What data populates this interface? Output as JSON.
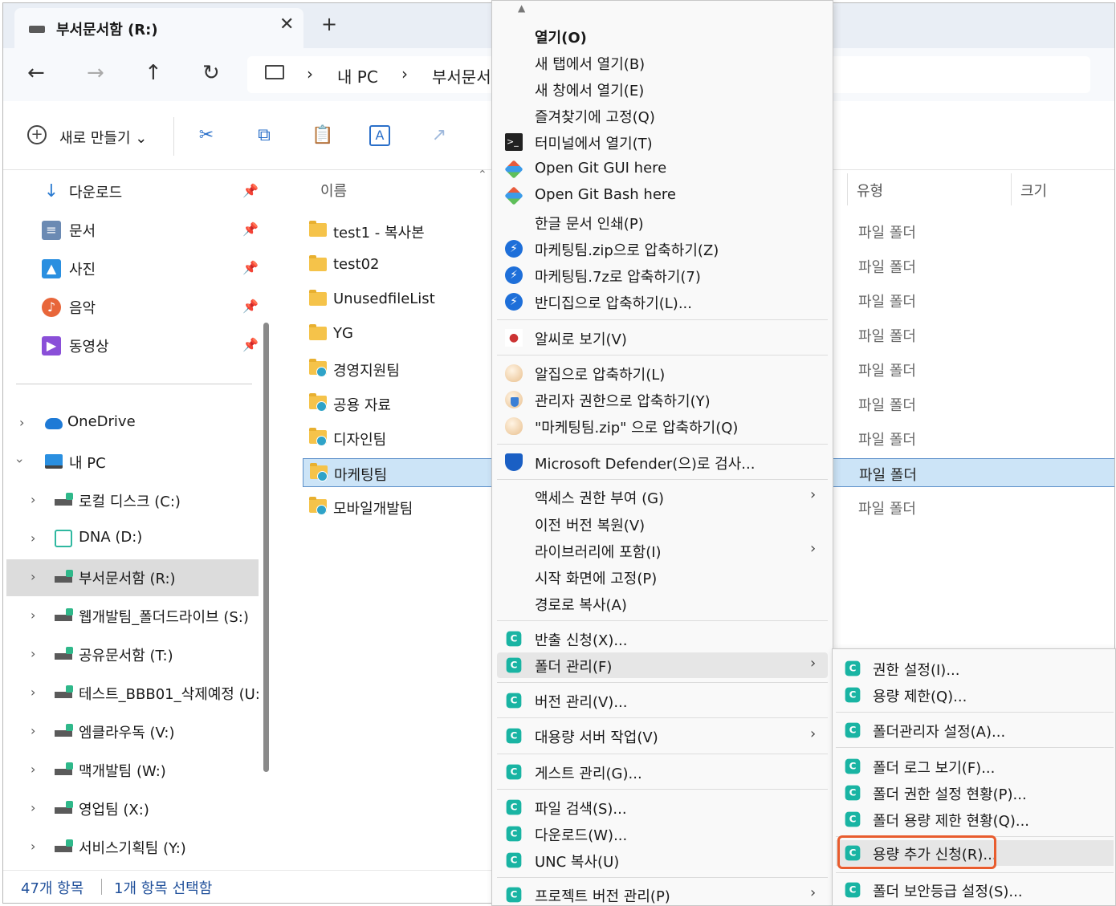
{
  "window": {
    "tab_title": "부서문서함 (R:)",
    "tab_close": "✕",
    "new_tab": "+"
  },
  "nav": {
    "back": "←",
    "forward": "→",
    "up": "↑",
    "refresh": "↻",
    "crumb_sep": "›",
    "breadcrumb": [
      "내 PC",
      "부서문서함 (R:)"
    ]
  },
  "toolbar": {
    "new_label": "새로 만들기 ⌄",
    "cut": "✂",
    "copy": "⧉",
    "paste": "📋",
    "rename": "A",
    "share": "↗"
  },
  "sidebar": {
    "quick_access": [
      {
        "label": "다운로드",
        "icon": "download-icon",
        "glyph": "↓",
        "color": "#2b7bd1"
      },
      {
        "label": "문서",
        "icon": "document-icon",
        "glyph": "≡",
        "color": "#6b8ab3"
      },
      {
        "label": "사진",
        "icon": "pictures-icon",
        "glyph": "▲",
        "color": "#2a8fe0"
      },
      {
        "label": "음악",
        "icon": "music-icon",
        "glyph": "♪",
        "color": "#e8663a"
      },
      {
        "label": "동영상",
        "icon": "video-icon",
        "glyph": "▶",
        "color": "#8a4fd8"
      }
    ],
    "pin_glyph": "📌",
    "onedrive": "OneDrive",
    "this_pc": "내 PC",
    "drives": [
      "로컬 디스크 (C:)",
      "DNA (D:)",
      "부서문서함 (R:)",
      "웹개발팀_폴더드라이브 (S:)",
      "공유문서함 (T:)",
      "테스트_BBB01_삭제예정 (U:",
      "엠클라우독 (V:)",
      "맥개발팀 (W:)",
      "영업팀 (X:)",
      "서비스기획팀 (Y:)"
    ]
  },
  "status": {
    "count": "47개 항목",
    "selected": "1개 항목 선택함"
  },
  "filelist": {
    "columns": {
      "name": "이름",
      "type": "유형",
      "size": "크기"
    },
    "sort_arrow": "⌃",
    "files": [
      {
        "name": "test1 - 복사본",
        "type": "파일 폴더",
        "shared": false
      },
      {
        "name": "test02",
        "type": "파일 폴더",
        "shared": false
      },
      {
        "name": "UnusedfileList",
        "type": "파일 폴더",
        "shared": false
      },
      {
        "name": "YG",
        "type": "파일 폴더",
        "shared": false
      },
      {
        "name": "경영지원팀",
        "type": "파일 폴더",
        "shared": true
      },
      {
        "name": "공용 자료",
        "type": "파일 폴더",
        "shared": true
      },
      {
        "name": "디자인팀",
        "type": "파일 폴더",
        "shared": true
      },
      {
        "name": "마케팅팀",
        "type": "파일 폴더",
        "shared": true
      },
      {
        "name": "모바일개발팀",
        "type": "파일 폴더",
        "shared": true
      }
    ]
  },
  "context_menu": {
    "items": [
      {
        "label": "열기(O)",
        "icon": "",
        "bold": true
      },
      {
        "label": "새 탭에서 열기(B)",
        "icon": ""
      },
      {
        "label": "새 창에서 열기(E)",
        "icon": ""
      },
      {
        "label": "즐겨찾기에 고정(Q)",
        "icon": ""
      },
      {
        "label": "터미널에서 열기(T)",
        "icon": "terminal-icon"
      },
      {
        "label": "Open Git GUI here",
        "icon": "git-icon"
      },
      {
        "label": "Open Git Bash here",
        "icon": "git-icon"
      },
      {
        "label": "한글 문서 인쇄(P)",
        "icon": ""
      },
      {
        "label": "마케팅팀.zip으로 압축하기(Z)",
        "icon": "bandizip-icon"
      },
      {
        "label": "마케팅팀.7z로 압축하기(7)",
        "icon": "bandizip-icon"
      },
      {
        "label": "반디집으로 압축하기(L)...",
        "icon": "bandizip-icon"
      },
      {
        "label": "알씨로 보기(V)",
        "icon": "alsee-icon"
      },
      {
        "label": "알집으로 압축하기(L)",
        "icon": "alzip-icon"
      },
      {
        "label": "관리자 권한으로 압축하기(Y)",
        "icon": "alzip-admin-icon"
      },
      {
        "label": "\"마케팅팀.zip\" 으로 압축하기(Q)",
        "icon": "alzip-icon"
      },
      {
        "label": "Microsoft Defender(으)로 검사...",
        "icon": "defender-icon"
      },
      {
        "label": "액세스 권한 부여 (G)",
        "icon": "",
        "submenu": true
      },
      {
        "label": "이전 버전 복원(V)",
        "icon": ""
      },
      {
        "label": "라이브러리에 포함(I)",
        "icon": "",
        "submenu": true
      },
      {
        "label": "시작 화면에 고정(P)",
        "icon": ""
      },
      {
        "label": "경로로 복사(A)",
        "icon": ""
      },
      {
        "label": "반출 신청(X)...",
        "icon": "cloud-c-icon"
      },
      {
        "label": "폴더 관리(F)",
        "icon": "cloud-c-icon",
        "submenu": true
      },
      {
        "label": "버전 관리(V)...",
        "icon": "cloud-c-icon"
      },
      {
        "label": "대용량 서버 작업(V)",
        "icon": "cloud-c-icon",
        "submenu": true
      },
      {
        "label": "게스트 관리(G)...",
        "icon": "cloud-c-icon"
      },
      {
        "label": "파일 검색(S)...",
        "icon": "cloud-c-icon"
      },
      {
        "label": "다운로드(W)...",
        "icon": "cloud-c-icon"
      },
      {
        "label": "UNC 복사(U)",
        "icon": "cloud-c-icon"
      },
      {
        "label": "프로젝트 버전 관리(P)",
        "icon": "cloud-c-icon",
        "submenu": true
      }
    ],
    "submenu_arrow": "›",
    "up_glyph": "▲",
    "c_glyph": "C",
    "term_glyph": ">_",
    "band_glyph": "⚡",
    "alsee_glyph": "●"
  },
  "folder_submenu": {
    "items": [
      {
        "label": "권한 설정(I)..."
      },
      {
        "label": "용량 제한(Q)..."
      },
      {
        "label": "폴더관리자 설정(A)..."
      },
      {
        "label": "폴더 로그 보기(F)..."
      },
      {
        "label": "폴더 권한 설정 현황(P)..."
      },
      {
        "label": "폴더 용량 제한 현황(Q)..."
      },
      {
        "label": "용량 추가 신청(R)...",
        "highlighted": true
      },
      {
        "label": "폴더 보안등급 설정(S)..."
      }
    ]
  }
}
